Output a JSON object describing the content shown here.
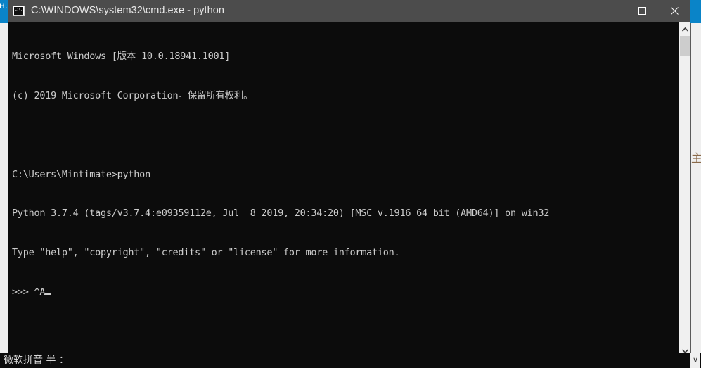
{
  "window": {
    "title": "C:\\WINDOWS\\system32\\cmd.exe - python",
    "icon": "cmd-console-icon",
    "titlebar_color": "#4c4c4c",
    "background_color": "#0c0c0c",
    "controls": {
      "minimize_label": "Minimize",
      "maximize_label": "Maximize",
      "close_label": "Close"
    }
  },
  "terminal": {
    "text_color": "#cccccc",
    "lines": [
      "Microsoft Windows [版本 10.0.18941.1001]",
      "(c) 2019 Microsoft Corporation。保留所有权利。",
      "",
      "C:\\Users\\Mintimate>python",
      "Python 3.7.4 (tags/v3.7.4:e09359112e, Jul  8 2019, 20:34:20) [MSC v.1916 64 bit (AMD64)] on win32",
      "Type \"help\", \"copyright\", \"credits\" or \"license\" for more information."
    ],
    "prompt": ">>> ^A"
  },
  "scrollbar": {
    "up_arrow": "chevron-up-icon",
    "down_arrow": "chevron-down-icon",
    "track_color": "#f0f0f0",
    "thumb_color": "#cdcdcd"
  },
  "ime": {
    "status_text": "微软拼音 半 ：",
    "cap_glyph": "∨"
  },
  "desktop": {
    "accent_color": "#0a84c8",
    "left_fragment_glyph": "н.",
    "right_fragment_glyph": "主"
  }
}
